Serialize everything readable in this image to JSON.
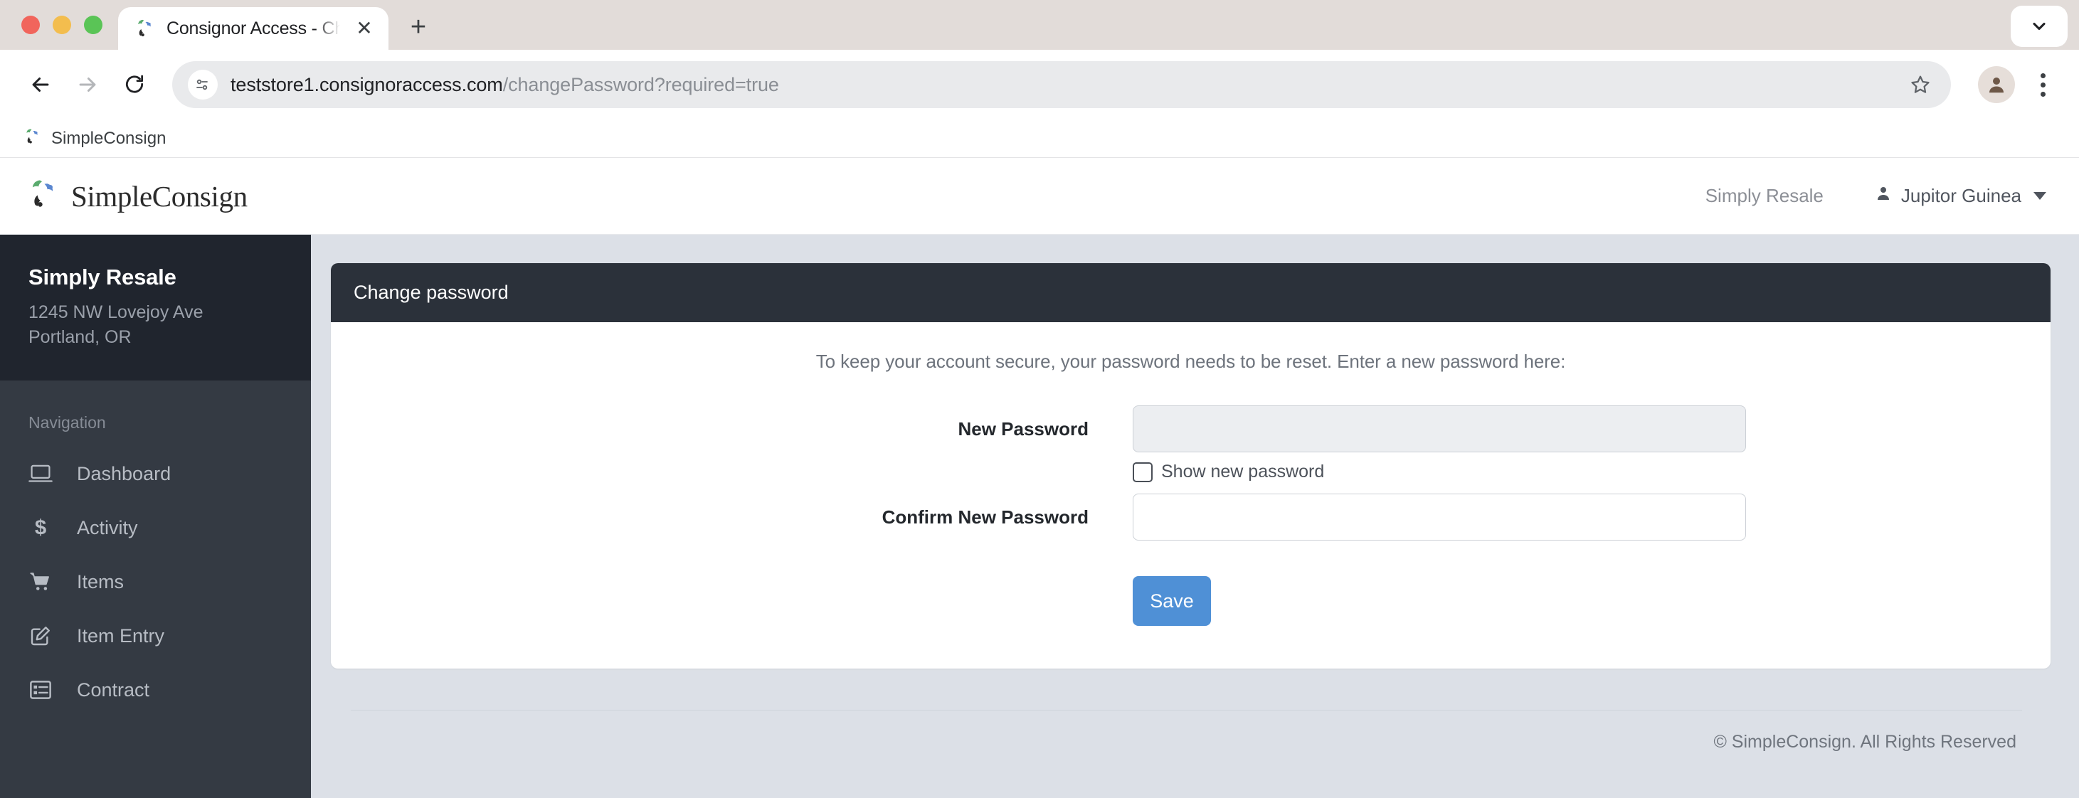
{
  "browser": {
    "tab": {
      "title": "Consignor Access - Change p",
      "favicon": "simpleconsign-logo-icon",
      "close": "✕"
    },
    "new_tab": "+",
    "tab_collapse_icon": "chevron-down-icon",
    "nav": {
      "back": "←",
      "forward": "→",
      "reload": "⟳"
    },
    "omnibox": {
      "domain": "teststore1.consignoraccess.com",
      "path": "/changePassword?required=true",
      "site_info_icon": "site-settings-icon"
    },
    "star_icon": "bookmark-star-icon",
    "profile_icon": "profile-avatar-icon",
    "menu_icon": "three-dot-menu-icon",
    "bookmarks": [
      {
        "label": "SimpleConsign",
        "icon": "simpleconsign-logo-icon"
      }
    ]
  },
  "app_header": {
    "brand": "SimpleConsign",
    "store": "Simply Resale",
    "user": "Jupitor Guinea",
    "user_icon": "person-icon",
    "caret_icon": "chevron-down-icon"
  },
  "sidebar": {
    "store_name": "Simply Resale",
    "address_line1": "1245 NW Lovejoy Ave",
    "address_line2": "Portland, OR",
    "section_label": "Navigation",
    "items": [
      {
        "label": "Dashboard",
        "icon": "laptop-icon"
      },
      {
        "label": "Activity",
        "icon": "dollar-icon"
      },
      {
        "label": "Items",
        "icon": "shopping-cart-icon"
      },
      {
        "label": "Item Entry",
        "icon": "pencil-square-icon"
      },
      {
        "label": "Contract",
        "icon": "list-table-icon"
      }
    ]
  },
  "main": {
    "card_title": "Change password",
    "intro": "To keep your account secure, your password needs to be reset. Enter a new password here:",
    "fields": {
      "new_password": {
        "label": "New Password",
        "value": "",
        "placeholder": ""
      },
      "show_new_password": {
        "label": "Show new password",
        "checked": false
      },
      "confirm_password": {
        "label": "Confirm New Password",
        "value": "",
        "placeholder": ""
      }
    },
    "save_label": "Save"
  },
  "footer": {
    "copyright": "© SimpleConsign. All Rights Reserved"
  },
  "colors": {
    "accent": "#4f90d6",
    "sidebar": "#343a43",
    "sidebar_head": "#20252e",
    "card_head": "#2b313a",
    "page_bg": "#dce0e7"
  }
}
